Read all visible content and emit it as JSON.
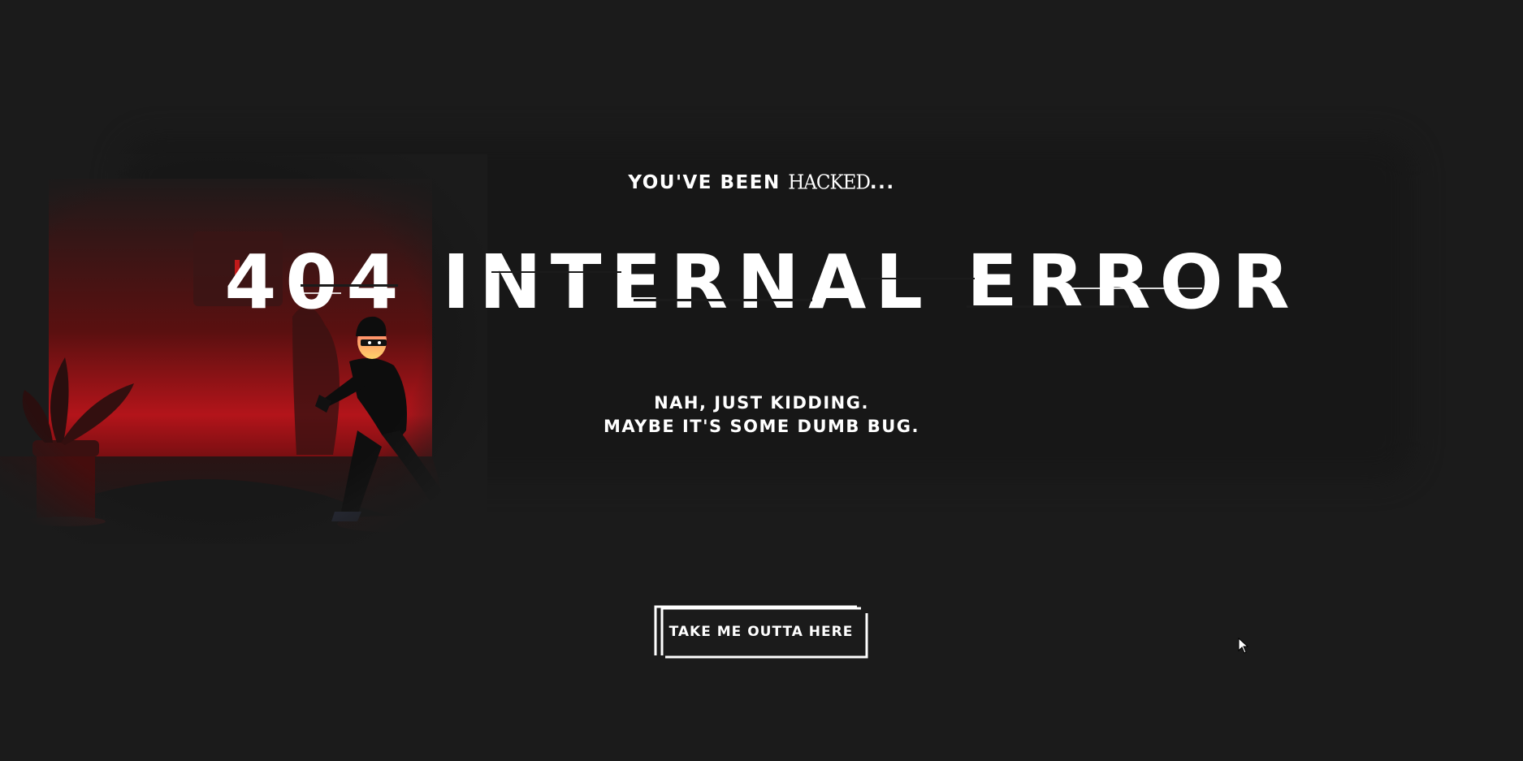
{
  "page": {
    "kicker_prefix": "YOU'VE BEEN",
    "kicker_glitch": "HACKED",
    "kicker_suffix": "...",
    "headline": "404 INTERNAL ERROR",
    "subtext_line1": "NAH, JUST KIDDING.",
    "subtext_line2": "MAYBE IT'S SOME DUMB BUG.",
    "cta_label": "TAKE ME OUTTA HERE"
  },
  "colors": {
    "background": "#1b1b1b",
    "text": "#ffffff",
    "accent_red": "#b3141a"
  },
  "icons": {
    "cursor": "mouse-pointer-icon"
  }
}
